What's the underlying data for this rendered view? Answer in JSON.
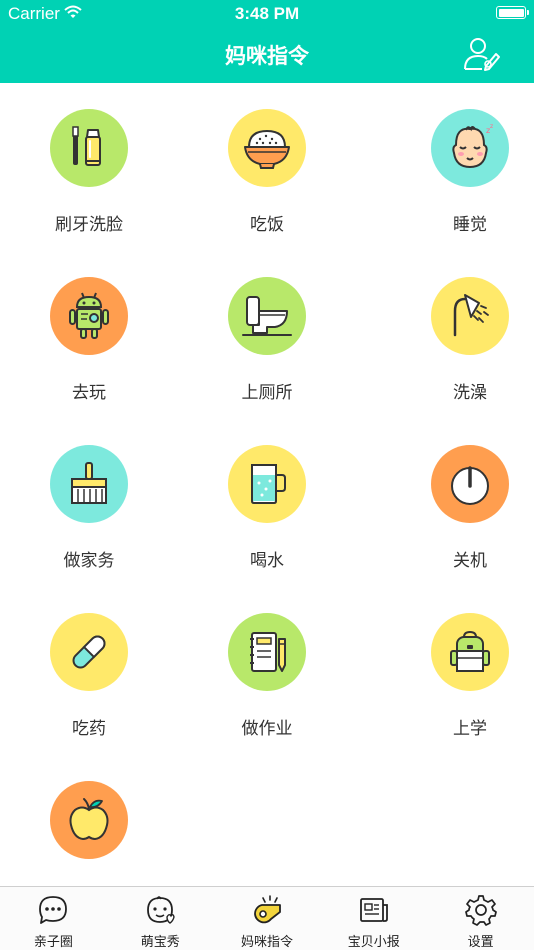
{
  "status_bar": {
    "carrier": "Carrier",
    "time": "3:48 PM"
  },
  "nav": {
    "title": "妈咪指令"
  },
  "commands": [
    {
      "label": "刷牙洗脸",
      "icon": "toothbrush-icon",
      "color": "#b8e86a"
    },
    {
      "label": "吃饭",
      "icon": "rice-bowl-icon",
      "color": "#ffe96a"
    },
    {
      "label": "睡觉",
      "icon": "sleeping-baby-icon",
      "color": "#7de9dd"
    },
    {
      "label": "去玩",
      "icon": "robot-toy-icon",
      "color": "#ff9e4f"
    },
    {
      "label": "上厕所",
      "icon": "toilet-icon",
      "color": "#b8e86a"
    },
    {
      "label": "洗澡",
      "icon": "shower-icon",
      "color": "#ffe96a"
    },
    {
      "label": "做家务",
      "icon": "broom-icon",
      "color": "#7de9dd"
    },
    {
      "label": "喝水",
      "icon": "water-cup-icon",
      "color": "#ffe96a"
    },
    {
      "label": "关机",
      "icon": "power-icon",
      "color": "#ff9e4f"
    },
    {
      "label": "吃药",
      "icon": "pill-icon",
      "color": "#ffe96a"
    },
    {
      "label": "做作业",
      "icon": "notebook-pencil-icon",
      "color": "#b8e86a"
    },
    {
      "label": "上学",
      "icon": "backpack-icon",
      "color": "#ffe96a"
    },
    {
      "label": "",
      "icon": "apple-icon",
      "color": "#ff9e4f"
    }
  ],
  "tabs": [
    {
      "label": "亲子圈",
      "icon": "chat-bubble-icon",
      "active": false
    },
    {
      "label": "萌宝秀",
      "icon": "baby-face-icon",
      "active": false
    },
    {
      "label": "妈咪指令",
      "icon": "whistle-icon",
      "active": true
    },
    {
      "label": "宝贝小报",
      "icon": "newspaper-icon",
      "active": false
    },
    {
      "label": "设置",
      "icon": "gear-icon",
      "active": false
    }
  ],
  "colors": {
    "brand": "#00d2b4",
    "green": "#b8e86a",
    "yellow": "#ffe96a",
    "teal": "#7de9dd",
    "orange": "#ff9e4f",
    "active_tab": "#f2d43c"
  }
}
